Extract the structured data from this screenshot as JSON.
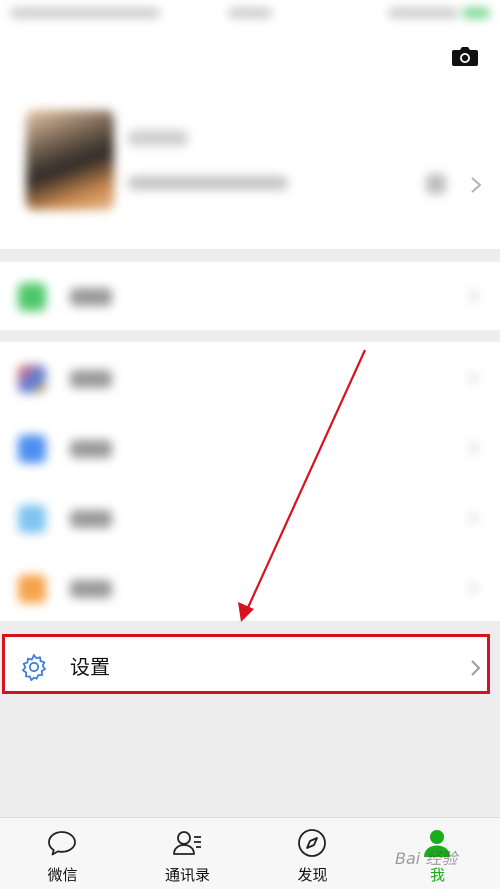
{
  "statusbar": {},
  "settings": {
    "label": "设置"
  },
  "tabbar": {
    "tabs": [
      {
        "label": "微信",
        "icon": "chat-bubble-icon"
      },
      {
        "label": "通讯录",
        "icon": "contacts-icon"
      },
      {
        "label": "发现",
        "icon": "compass-icon"
      },
      {
        "label": "我",
        "icon": "me-person-icon",
        "active": true
      }
    ]
  },
  "colors": {
    "accent_green": "#1aad19",
    "highlight_red": "#d8111e",
    "gear_blue": "#3d7fe0"
  },
  "watermark": "Bai 经验"
}
